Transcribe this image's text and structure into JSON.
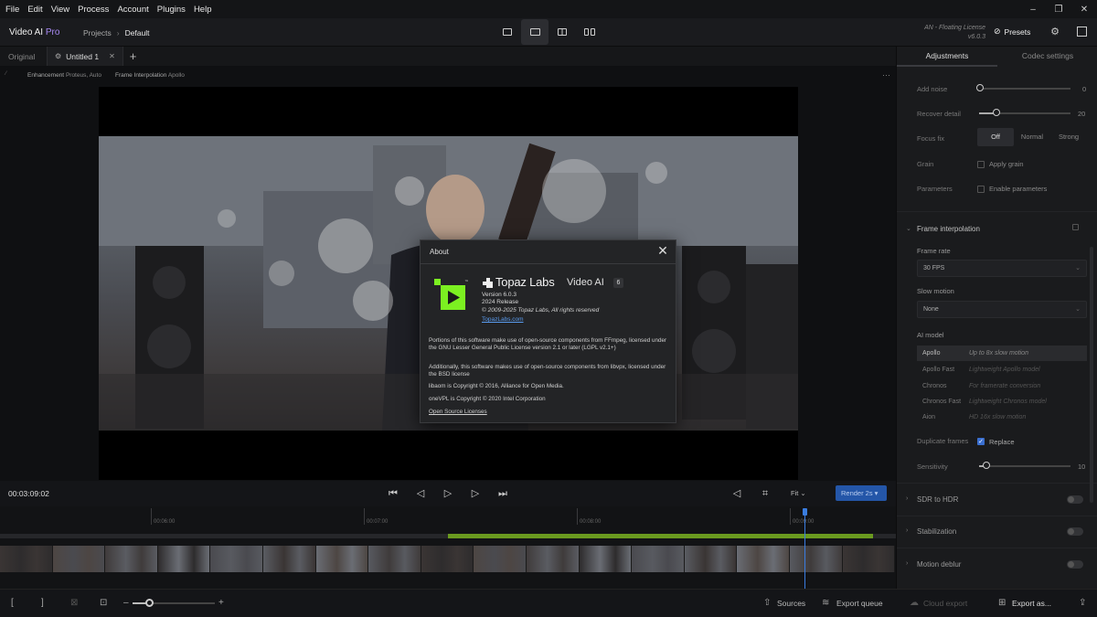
{
  "menu": [
    "File",
    "Edit",
    "View",
    "Process",
    "Account",
    "Plugins",
    "Help"
  ],
  "window": {
    "minimize": "–",
    "maximize": "❐",
    "close": "✕"
  },
  "header": {
    "app_name": "Video AI ",
    "app_tier": "Pro",
    "crumb_1": "Projects",
    "crumb_sep": "›",
    "crumb_2": "Default",
    "license_line1": "AN - Floating License",
    "license_line2": "v6.0.3",
    "presets_label": "Presets"
  },
  "tabs": {
    "original": "Original",
    "untitled": "Untitled 1",
    "close": "✕",
    "add": "+"
  },
  "infobar": {
    "enhancement_label": "Enhancement",
    "enhancement_value": "Proteus, Auto",
    "interp_label": "Frame Interpolation",
    "interp_value": "Apollo",
    "more": "···"
  },
  "about": {
    "title": "About",
    "brand": "Topaz Labs",
    "tm": "™",
    "product": "Video AI",
    "badge": "6",
    "version": "Version 6.0.3",
    "release": "2024 Release",
    "copyright": "© 2009-2025 Topaz Labs, All rights reserved",
    "site_link": "TopazLabs.com",
    "para1": "Portions of this software make use of open-source components from FFmpeg, licensed under the GNU Lesser General Public License version 2.1 or later (LGPL v2.1+)",
    "para2": "Additionally, this software makes use of open-source components from libvpx, licensed under the BSD license",
    "para3": "libaom is Copyright © 2016, Alliance for Open Media.",
    "para4": "oneVPL is Copyright © 2020 Intel Corporation",
    "licenses_link": "Open Source Licenses",
    "logo_color": "#7cf021"
  },
  "transport": {
    "timecode": "00:03:09:02",
    "fit_label": "Fit ⌄",
    "render_label": "Render 2s  ▾"
  },
  "timeline": {
    "marks": [
      "00:06:00",
      "00:07:00",
      "00:08:00",
      "00:09:00"
    ]
  },
  "bottom": {
    "sources": "Sources",
    "export_queue": "Export queue",
    "cloud_export": "Cloud export",
    "export_as": "Export as..."
  },
  "panel": {
    "tab_adjustments": "Adjustments",
    "tab_codec": "Codec settings",
    "add_noise_label": "Add noise",
    "add_noise_value": "0",
    "recover_label": "Recover detail",
    "recover_value": "20",
    "focus_label": "Focus fix",
    "focus_options": [
      "Off",
      "Normal",
      "Strong"
    ],
    "grain_label": "Grain",
    "apply_grain": "Apply grain",
    "params_label": "Parameters",
    "enable_params": "Enable parameters",
    "frame_interp": "Frame interpolation",
    "frame_rate_label": "Frame rate",
    "frame_rate_value": "30 FPS",
    "slow_motion_label": "Slow motion",
    "slow_motion_value": "None",
    "ai_model_label": "AI model",
    "models": [
      {
        "name": "Apollo",
        "desc": "Up to 8x slow motion"
      },
      {
        "name": "Apollo Fast",
        "desc": "Lightweight Apollo model"
      },
      {
        "name": "Chronos",
        "desc": "For framerate conversion"
      },
      {
        "name": "Chronos Fast",
        "desc": "Lightweight Chronos model"
      },
      {
        "name": "Aion",
        "desc": "HD 16x slow motion"
      }
    ],
    "dup_frames_label": "Duplicate frames",
    "replace_label": "Replace",
    "sensitivity_label": "Sensitivity",
    "sensitivity_value": "10",
    "sdr_hdr": "SDR to HDR",
    "stabilization": "Stabilization",
    "motion_deblur": "Motion deblur"
  }
}
